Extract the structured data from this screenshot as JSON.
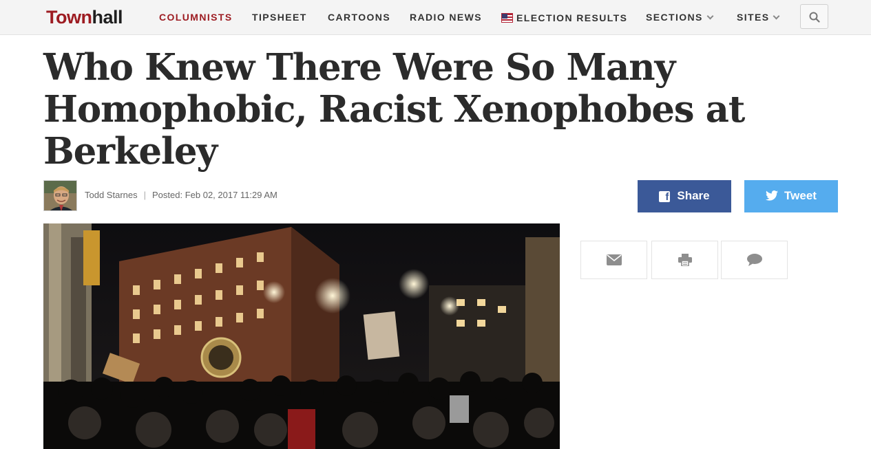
{
  "brand": {
    "logo_part1": "Town",
    "logo_part2": "hall",
    "brand_red": "#9d1c22"
  },
  "nav": {
    "items": [
      {
        "label": "COLUMNISTS",
        "active": true
      },
      {
        "label": "TIPSHEET"
      },
      {
        "label": "CARTOONS"
      },
      {
        "label": "RADIO NEWS"
      },
      {
        "label": "ELECTION RESULTS",
        "icon": "us-flag-icon"
      },
      {
        "label": "SECTIONS",
        "icon": "chevron-down-icon"
      },
      {
        "label": "SITES",
        "icon": "chevron-down-icon"
      }
    ],
    "search_icon": "search-icon"
  },
  "article": {
    "headline": "Who Knew There Were So Many Homophobic, Racist Xenophobes at Berkeley",
    "author": "Todd Starnes",
    "posted": "Posted: Feb 02, 2017 11:29 AM"
  },
  "share": {
    "facebook_label": "Share",
    "twitter_label": "Tweet",
    "facebook_color": "#3b5998",
    "twitter_color": "#55acee"
  },
  "actions": [
    {
      "icon": "email-icon"
    },
    {
      "icon": "print-icon"
    },
    {
      "icon": "comment-icon"
    }
  ]
}
